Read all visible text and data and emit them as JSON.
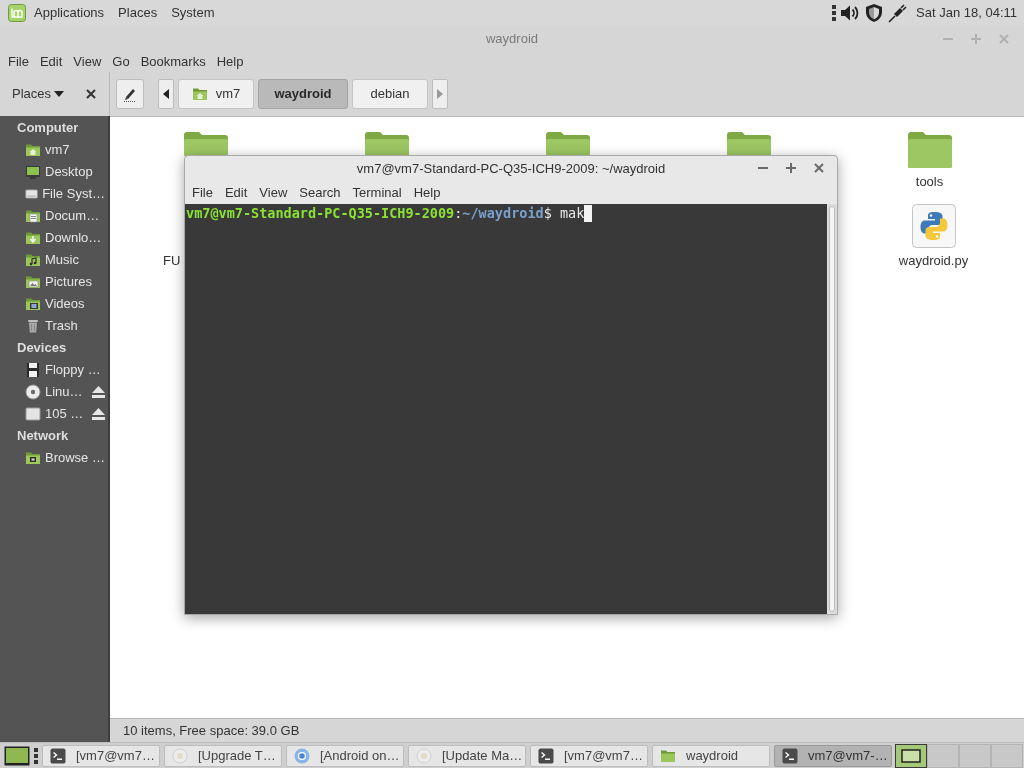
{
  "top_panel": {
    "menus": [
      "Applications",
      "Places",
      "System"
    ],
    "clock": "Sat Jan 18, 04:11"
  },
  "file_manager": {
    "title": "waydroid",
    "menu": [
      "File",
      "Edit",
      "View",
      "Go",
      "Bookmarks",
      "Help"
    ],
    "side_pane": "Places",
    "path_buttons": [
      {
        "label": "vm7",
        "kind": "home",
        "selected": false
      },
      {
        "label": "waydroid",
        "kind": "folder",
        "selected": true
      },
      {
        "label": "debian",
        "kind": "folder",
        "selected": false
      }
    ],
    "sidebar": [
      {
        "heading": "Computer",
        "items": [
          {
            "label": "vm7",
            "kind": "home"
          },
          {
            "label": "Desktop",
            "kind": "desktop"
          },
          {
            "label": "File Syst…",
            "kind": "filesystem"
          },
          {
            "label": "Docum…",
            "kind": "documents"
          },
          {
            "label": "Downlo…",
            "kind": "downloads"
          },
          {
            "label": "Music",
            "kind": "music"
          },
          {
            "label": "Pictures",
            "kind": "pictures"
          },
          {
            "label": "Videos",
            "kind": "videos"
          },
          {
            "label": "Trash",
            "kind": "trash"
          }
        ]
      },
      {
        "heading": "Devices",
        "items": [
          {
            "label": "Floppy …",
            "kind": "floppy",
            "ejectable": false
          },
          {
            "label": "Linu…",
            "kind": "optical",
            "ejectable": true
          },
          {
            "label": "105 …",
            "kind": "drive",
            "ejectable": true
          }
        ]
      },
      {
        "heading": "Network",
        "items": [
          {
            "label": "Browse …",
            "kind": "network"
          }
        ]
      }
    ],
    "icon_rows": [
      [
        {
          "kind": "folder_top"
        },
        {
          "kind": "folder_top"
        },
        {
          "kind": "folder_top"
        },
        {
          "kind": "folder_top"
        },
        {
          "kind": "folder",
          "label": "tools"
        }
      ],
      [
        {
          "kind": "label_only",
          "label": "FU"
        },
        {
          "kind": "python",
          "label": "waydroid.py"
        }
      ]
    ],
    "status_bar": "10 items, Free space: 39.0 GB"
  },
  "terminal": {
    "title": "vm7@vm7-Standard-PC-Q35-ICH9-2009: ~/waydroid",
    "menu": [
      "File",
      "Edit",
      "View",
      "Search",
      "Terminal",
      "Help"
    ],
    "prompt": {
      "user_host": "vm7@vm7-Standard-PC-Q35-ICH9-2009",
      "separator": ":",
      "path": "~/waydroid",
      "symbol": "$",
      "command": "mak"
    }
  },
  "taskbar": {
    "tasks": [
      {
        "label": "[vm7@vm7…",
        "kind": "terminal",
        "selected": false
      },
      {
        "label": "[Upgrade T…",
        "kind": "app",
        "selected": false
      },
      {
        "label": "[Android on…",
        "kind": "browser",
        "selected": false
      },
      {
        "label": "[Update Ma…",
        "kind": "app",
        "selected": false
      },
      {
        "label": "[vm7@vm7…",
        "kind": "terminal",
        "selected": false
      },
      {
        "label": "waydroid",
        "kind": "folder",
        "selected": false
      },
      {
        "label": "vm7@vm7-…",
        "kind": "terminal",
        "selected": true
      }
    ],
    "workspaces": [
      {
        "selected": true
      },
      {
        "selected": false
      },
      {
        "selected": false
      },
      {
        "selected": false
      }
    ]
  }
}
